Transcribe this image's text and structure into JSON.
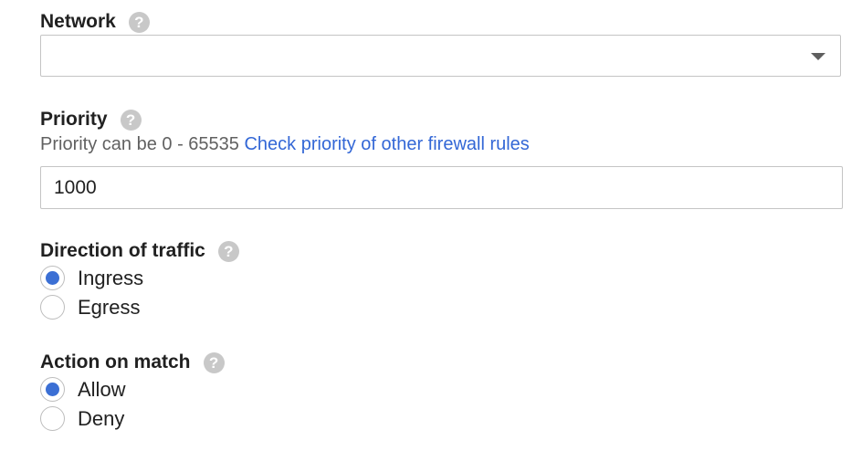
{
  "network": {
    "label": "Network",
    "help_icon": "question-mark-icon",
    "selected_value": "",
    "caret_icon": "caret-down-icon"
  },
  "priority": {
    "label": "Priority",
    "help_icon": "question-mark-icon",
    "hint_text": "Priority can be 0 - 65535",
    "hint_link": "Check priority of other firewall rules",
    "value": "1000"
  },
  "direction": {
    "label": "Direction of traffic",
    "help_icon": "question-mark-icon",
    "options": [
      {
        "label": "Ingress",
        "checked": true
      },
      {
        "label": "Egress",
        "checked": false
      }
    ]
  },
  "action": {
    "label": "Action on match",
    "help_icon": "question-mark-icon",
    "options": [
      {
        "label": "Allow",
        "checked": true
      },
      {
        "label": "Deny",
        "checked": false
      }
    ]
  },
  "colors": {
    "link": "#3367d6",
    "radio_selected": "#3b6fd4",
    "help_icon_bg": "#c8c8c8"
  }
}
